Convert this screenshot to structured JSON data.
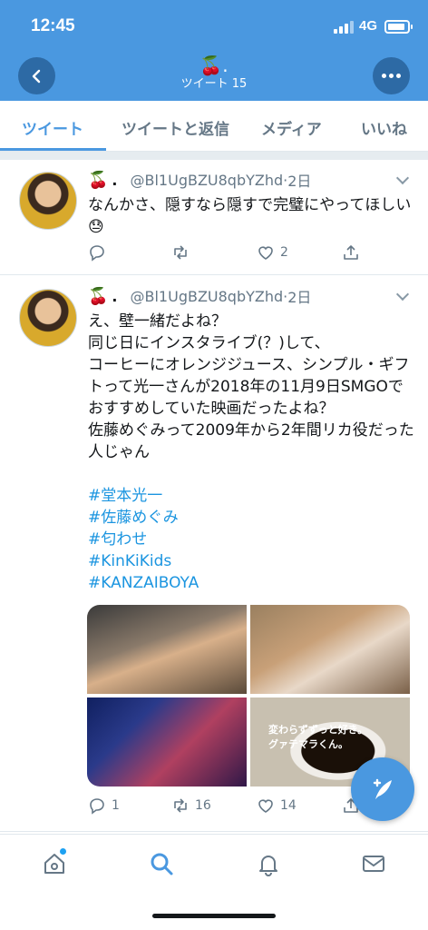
{
  "status_bar": {
    "time": "12:45",
    "network": "4G"
  },
  "header": {
    "title_emoji": "🍒.",
    "title": "ツイート 15"
  },
  "tabs": [
    "ツイート",
    "ツイートと返信",
    "メディア",
    "いいね"
  ],
  "tweets": [
    {
      "name_emoji": "🍒",
      "name_dot": ".",
      "handle": "@Bl1UgBZU8qbYZhd",
      "time": "2日",
      "text": "なんかさ、隠すなら隠すで完璧にやってほしい😓",
      "replies": "",
      "retweets": "",
      "likes": "2"
    },
    {
      "name_emoji": "🍒",
      "name_dot": ".",
      "handle": "@Bl1UgBZU8qbYZhd",
      "time": "2日",
      "text": "え、壁一緒だよね？\n同じ日にインスタライブ(？)して、\nコーヒーにオレンジジュース、シンプル・ギフトって光一さんが2018年の11月9日SMGOでおすすめしていた映画だったよね？\n佐藤めぐみって2009年から2年間リカ役だった人じゃん",
      "hashtags": [
        "#堂本光一",
        "#佐藤めぐみ",
        "#匂わせ",
        "#KinKiKids",
        "#KANZAIBOYA"
      ],
      "media_caption": "変わらずずっと好き。\nグァテマラくん。",
      "replies": "1",
      "retweets": "16",
      "likes": "14"
    }
  ],
  "nav": [
    "home-icon",
    "search-icon",
    "bell-icon",
    "mail-icon"
  ],
  "colors": {
    "brand": "#4a98e0",
    "header_button": "#2d6aa5",
    "link": "#1b95e0",
    "secondary": "#657786"
  }
}
